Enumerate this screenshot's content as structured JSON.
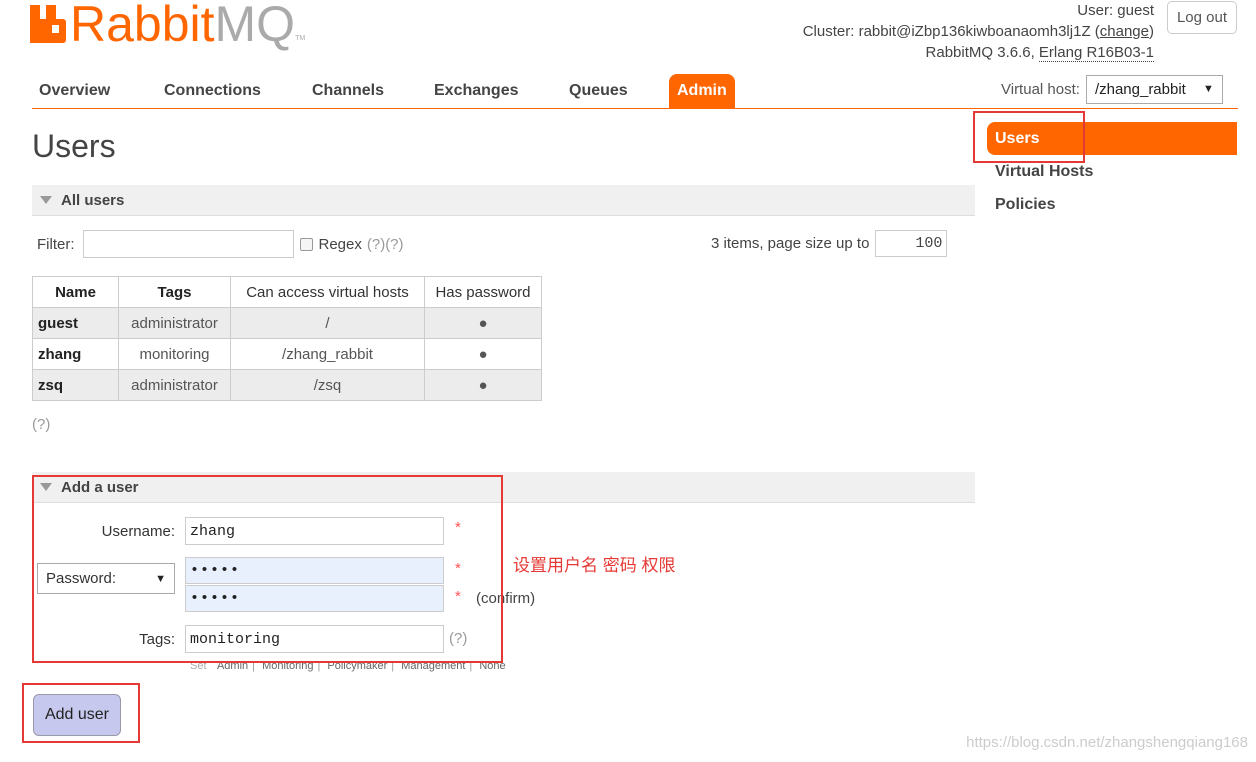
{
  "logo": {
    "text_brand": "Rabbit",
    "text_mq": "MQ",
    "tm": "TM"
  },
  "header": {
    "user_label": "User:",
    "user_name": "guest",
    "cluster_label": "Cluster:",
    "cluster_name": "rabbit@iZbp136kiwboanaomh3lj1Z",
    "change_link": "change",
    "version": "RabbitMQ 3.6.6,",
    "erlang": "Erlang R16B03-1",
    "logout": "Log out"
  },
  "nav": {
    "tabs": [
      {
        "label": "Overview"
      },
      {
        "label": "Connections"
      },
      {
        "label": "Channels"
      },
      {
        "label": "Exchanges"
      },
      {
        "label": "Queues"
      },
      {
        "label": "Admin"
      }
    ],
    "active": "Admin"
  },
  "vhost": {
    "label": "Virtual host:",
    "value": "/zhang_rabbit"
  },
  "sidebar": {
    "items": [
      {
        "label": "Users"
      },
      {
        "label": "Virtual Hosts"
      },
      {
        "label": "Policies"
      }
    ],
    "active": "Users"
  },
  "page": {
    "title": "Users"
  },
  "all_users": {
    "header": "All users",
    "filter_label": "Filter:",
    "filter_value": "",
    "regex_label": "Regex",
    "regex_help": "(?)(?)",
    "items_text": "3 items, page size up to",
    "page_size": "100",
    "columns": [
      "Name",
      "Tags",
      "Can access virtual hosts",
      "Has password"
    ],
    "rows": [
      {
        "name": "guest",
        "tags": "administrator",
        "vhosts": "/",
        "has_password": "●"
      },
      {
        "name": "zhang",
        "tags": "monitoring",
        "vhosts": "/zhang_rabbit",
        "has_password": "●"
      },
      {
        "name": "zsq",
        "tags": "administrator",
        "vhosts": "/zsq",
        "has_password": "●"
      }
    ],
    "help": "(?)"
  },
  "add_user": {
    "header": "Add a user",
    "username_label": "Username:",
    "username_value": "zhang",
    "password_select": "Password:",
    "password_value": "•••••",
    "confirm_value": "•••••",
    "confirm_label": "(confirm)",
    "required_mark": "*",
    "tags_label": "Tags:",
    "tags_value": "monitoring",
    "tags_help": "(?)",
    "tag_links_set": "Set",
    "tag_links": [
      "Admin",
      "Monitoring",
      "Policymaker",
      "Management",
      "None"
    ],
    "submit": "Add user"
  },
  "annotation": {
    "text": "设置用户名 密码 权限",
    "color": "#e53935"
  },
  "watermark": "https://blog.csdn.net/zhangshengqiang168",
  "colors": {
    "accent": "#ff6600",
    "annotation": "#e53935"
  }
}
